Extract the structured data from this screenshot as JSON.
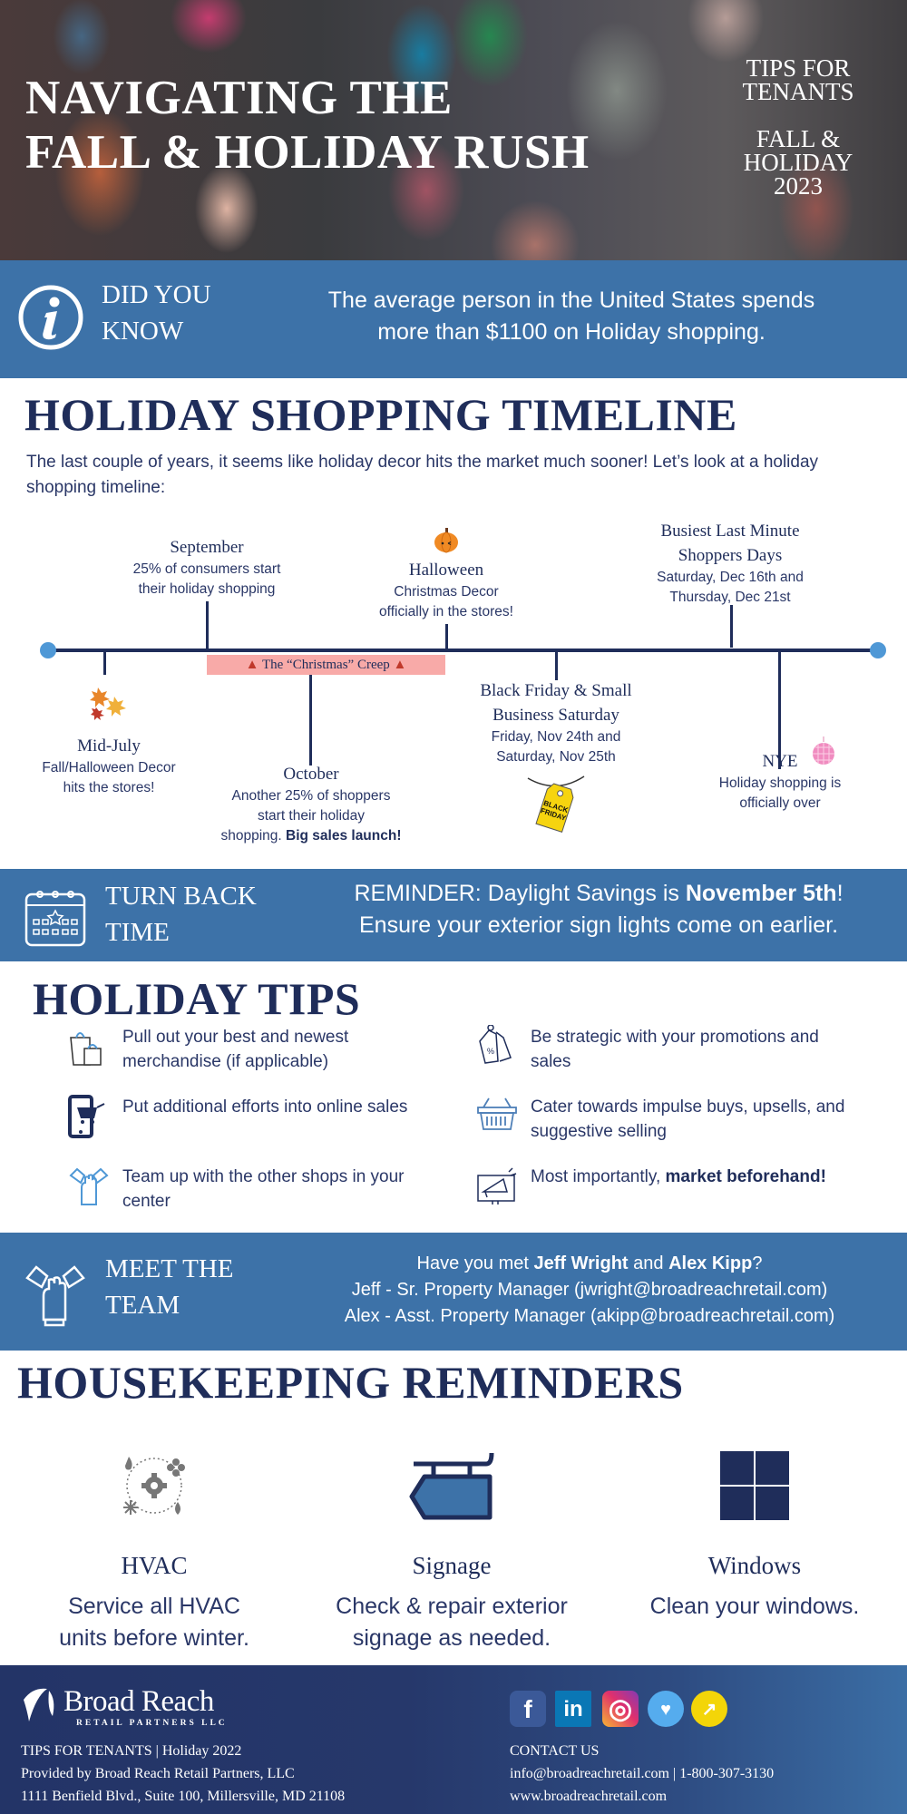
{
  "hero": {
    "title_line1": "NAVIGATING THE",
    "title_line2": "FALL & HOLIDAY RUSH",
    "side_line1": "TIPS FOR",
    "side_line2": "TENANTS",
    "side_line3": "FALL &",
    "side_line4": "HOLIDAY",
    "side_line5": "2023"
  },
  "did_you_know": {
    "icon": "info-icon",
    "title_line1": "DID YOU",
    "title_line2": "KNOW",
    "text_line1": "The average person in the United States spends",
    "text_line2": "more than $1100 on Holiday shopping."
  },
  "timeline": {
    "heading": "HOLIDAY SHOPPING TIMELINE",
    "intro": "The last couple of years, it seems like holiday decor hits the market much sooner! Let’s look at a holiday shopping timeline:",
    "creep_label": "The “Christmas” Creep",
    "events": {
      "mid_july": {
        "title": "Mid-July",
        "text_line1": "Fall/Halloween Decor",
        "text_line2": "hits the stores!",
        "icon": "fall-leaves-icon"
      },
      "september": {
        "title": "September",
        "text_line1": "25% of consumers start",
        "text_line2": "their holiday shopping"
      },
      "october": {
        "title": "October",
        "text_line1": "Another 25% of shoppers",
        "text_line2": "start their holiday",
        "text_line3_plain": "shopping. ",
        "text_line3_bold": "Big sales launch!"
      },
      "halloween": {
        "title": "Halloween",
        "text_line1": "Christmas Decor",
        "text_line2": "officially in the stores!",
        "icon": "pumpkin-icon"
      },
      "black_friday": {
        "title_line1": "Black Friday & Small",
        "title_line2": "Business Saturday",
        "text_line1": "Friday, Nov 24th and",
        "text_line2": "Saturday, Nov 25th",
        "icon": "black-friday-tag-icon",
        "tag_line1": "BLACK",
        "tag_line2": "FRIDAY"
      },
      "busiest": {
        "title_line1": "Busiest Last Minute",
        "title_line2": "Shoppers Days",
        "text_line1": "Saturday, Dec 16th and",
        "text_line2": "Thursday, Dec 21st"
      },
      "nye": {
        "title": "NYE",
        "text_line1": "Holiday shopping is",
        "text_line2": "officially over",
        "icon": "disco-ball-icon"
      }
    }
  },
  "turn_back_time": {
    "icon": "calendar-icon",
    "title_line1": "TURN BACK",
    "title_line2": "TIME",
    "text_line1_plain": "REMINDER: Daylight Savings is ",
    "text_line1_bold": "November 5th",
    "text_line1_end": "!",
    "text_line2": "Ensure your exterior sign lights come on earlier."
  },
  "tips": {
    "heading": "HOLIDAY TIPS",
    "items": [
      {
        "icon": "shopping-bags-icon",
        "text": "Pull out your best and newest merchandise (if applicable)"
      },
      {
        "icon": "mobile-cart-icon",
        "text": "Put additional efforts into online sales"
      },
      {
        "icon": "team-hands-icon",
        "text": "Team up with the other shops in your center"
      },
      {
        "icon": "price-tags-icon",
        "text": "Be strategic with your promotions and sales"
      },
      {
        "icon": "basket-icon",
        "text": "Cater towards impulse buys, upsells, and suggestive selling"
      },
      {
        "icon": "megaphone-icon",
        "text_plain": "Most importantly, ",
        "text_bold": "market beforehand!"
      }
    ]
  },
  "meet_team": {
    "icon": "team-hands-icon",
    "title_line1": "MEET THE",
    "title_line2": "TEAM",
    "line1_a": "Have you met ",
    "line1_b": "Jeff Wright",
    "line1_c": " and ",
    "line1_d": "Alex Kipp",
    "line1_e": "?",
    "line2": "Jeff - Sr. Property Manager (jwright@broadreachretail.com)",
    "line3": "Alex - Asst. Property Manager (akipp@broadreachretail.com)"
  },
  "housekeeping": {
    "heading": "HOUSEKEEPING REMINDERS",
    "items": [
      {
        "icon": "hvac-icon",
        "title": "HVAC",
        "text_line1": "Service all HVAC",
        "text_line2": "units before winter."
      },
      {
        "icon": "signage-icon",
        "title": "Signage",
        "text_line1": "Check & repair exterior",
        "text_line2": "signage as needed."
      },
      {
        "icon": "window-icon",
        "title": "Windows",
        "text_line1": "Clean your windows.",
        "text_line2": ""
      }
    ]
  },
  "footer": {
    "logo_name": "Broad Reach",
    "logo_sub": "RETAIL PARTNERS LLC",
    "left_line1": "TIPS FOR TENANTS | Holiday 2022",
    "left_line2": "Provided by Broad Reach Retail Partners, LLC",
    "left_line3": "1111 Benfield Blvd., Suite 100, Millersville, MD 21108",
    "contact_heading": "CONTACT US",
    "contact_line1": "info@broadreachretail.com | 1-800-307-3130",
    "contact_line2": "www.broadreachretail.com",
    "social": [
      {
        "name": "facebook",
        "glyph": "f",
        "color": "#3b5998"
      },
      {
        "name": "linkedin",
        "glyph": "in",
        "color": "#0a77b5"
      },
      {
        "name": "instagram",
        "glyph": "◎",
        "color": "#d6307a"
      },
      {
        "name": "twitter",
        "glyph": "♥",
        "color": "#55acee"
      },
      {
        "name": "website",
        "glyph": "↗",
        "color": "#f3d508"
      }
    ]
  },
  "colors": {
    "navy": "#1f2d5a",
    "band_blue": "#3d72a8",
    "timeline_dot": "#4f98d6",
    "creep_pink": "#f8aaa8"
  }
}
